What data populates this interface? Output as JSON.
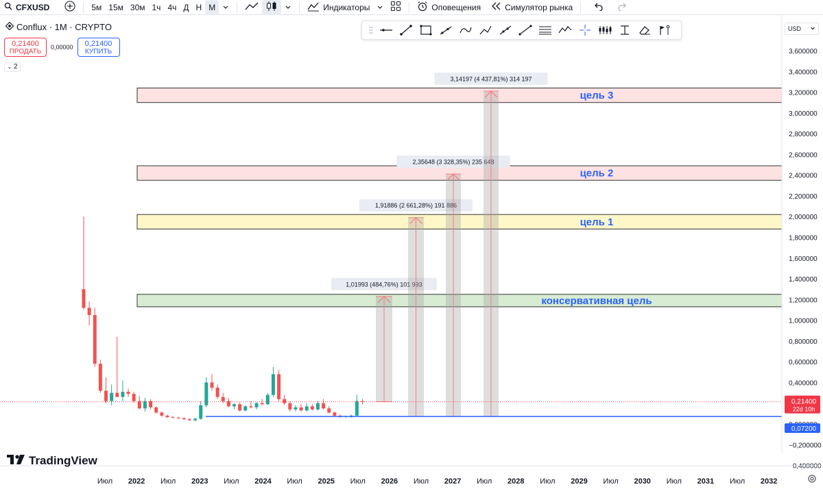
{
  "toolbar": {
    "symbol": "CFXUSD",
    "intervals": [
      "5м",
      "15м",
      "30м",
      "1ч",
      "4ч",
      "Д",
      "Н",
      "М"
    ],
    "active_interval": "М",
    "indicators_label": "Индикаторы",
    "alerts_label": "Оповещения",
    "replay_label": "Симулятор рынка"
  },
  "legend": {
    "title": "Conflux · 1M · CRYPTO"
  },
  "trade": {
    "sell_price": "0,21400",
    "sell_label": "ПРОДАТЬ",
    "spread": "0,00000",
    "buy_price": "0,21400",
    "buy_label": "КУПИТЬ"
  },
  "collapse": {
    "count": "2"
  },
  "currency": {
    "label": "USD"
  },
  "price_axis": {
    "ticks": [
      "3,600000",
      "3,400000",
      "3,200000",
      "3,000000",
      "2,800000",
      "2,600000",
      "2,400000",
      "2,200000",
      "2,000000",
      "1,800000",
      "1,600000",
      "1,400000",
      "1,200000",
      "1,000000",
      "0,800000",
      "0,600000",
      "0,400000",
      "0,000000",
      "−0,200000",
      "−0,400000"
    ],
    "tick_values": [
      3.6,
      3.4,
      3.2,
      3.0,
      2.8,
      2.6,
      2.4,
      2.2,
      2.0,
      1.8,
      1.6,
      1.4,
      1.2,
      1.0,
      0.8,
      0.6,
      0.4,
      0.0,
      -0.2,
      -0.4
    ],
    "last_price": "0,21400",
    "last_price_value": 0.214,
    "countdown": "22d 10h",
    "support_label": "0,07200",
    "support_value": 0.072
  },
  "time_axis": {
    "labels": [
      "Июл",
      "2022",
      "Июл",
      "2023",
      "Июл",
      "2024",
      "Июл",
      "2025",
      "Июл",
      "2026",
      "Июл",
      "2027",
      "Июл",
      "2028",
      "Июл",
      "2029",
      "Июл",
      "2030",
      "Июл",
      "2031",
      "Июл",
      "2032"
    ]
  },
  "zones": [
    {
      "label": "консервативная цель",
      "low": 1.13,
      "high": 1.25,
      "color": "#d8ecd4",
      "border": "#333333"
    },
    {
      "label": "цель 1",
      "low": 1.88,
      "high": 2.02,
      "color": "#fff7c8",
      "border": "#333333"
    },
    {
      "label": "цель 2",
      "low": 2.35,
      "high": 2.49,
      "color": "#fde2e2",
      "border": "#333333"
    },
    {
      "label": "цель 3",
      "low": 3.1,
      "high": 3.24,
      "color": "#fde2e2",
      "border": "#333333"
    }
  ],
  "measures": [
    {
      "label": "1,01993 (484,76%) 101 993",
      "top": 1.23
    },
    {
      "label": "1,91886 (2 661,28%) 191 886",
      "top": 1.99
    },
    {
      "label": "2,35648 (3 328,35%) 235 648",
      "top": 2.41
    },
    {
      "label": "3,14197 (4 437,81%) 314 197",
      "top": 3.21
    }
  ],
  "colors": {
    "up": "#26a69a",
    "down": "#ef5350",
    "zone_text": "#2962ff",
    "support": "#2962ff",
    "last": "#f23645"
  },
  "brand": {
    "name": "TradingView"
  },
  "chart_data": {
    "type": "candlestick",
    "ylim": [
      -0.4,
      3.65
    ],
    "candles": [
      {
        "o": 1.3,
        "h": 2.0,
        "l": 1.1,
        "c": 1.12
      },
      {
        "o": 1.12,
        "h": 1.18,
        "l": 0.95,
        "c": 1.05
      },
      {
        "o": 1.05,
        "h": 1.12,
        "l": 0.55,
        "c": 0.58
      },
      {
        "o": 0.58,
        "h": 0.62,
        "l": 0.3,
        "c": 0.32
      },
      {
        "o": 0.32,
        "h": 0.45,
        "l": 0.2,
        "c": 0.22
      },
      {
        "o": 0.22,
        "h": 0.38,
        "l": 0.18,
        "c": 0.3
      },
      {
        "o": 0.3,
        "h": 0.84,
        "l": 0.26,
        "c": 0.26
      },
      {
        "o": 0.26,
        "h": 0.42,
        "l": 0.22,
        "c": 0.31
      },
      {
        "o": 0.31,
        "h": 0.34,
        "l": 0.26,
        "c": 0.29
      },
      {
        "o": 0.29,
        "h": 0.31,
        "l": 0.2,
        "c": 0.22
      },
      {
        "o": 0.22,
        "h": 0.27,
        "l": 0.14,
        "c": 0.15
      },
      {
        "o": 0.15,
        "h": 0.25,
        "l": 0.12,
        "c": 0.22
      },
      {
        "o": 0.22,
        "h": 0.24,
        "l": 0.14,
        "c": 0.16
      },
      {
        "o": 0.16,
        "h": 0.17,
        "l": 0.1,
        "c": 0.11
      },
      {
        "o": 0.11,
        "h": 0.12,
        "l": 0.07,
        "c": 0.08
      },
      {
        "o": 0.08,
        "h": 0.09,
        "l": 0.06,
        "c": 0.065
      },
      {
        "o": 0.065,
        "h": 0.075,
        "l": 0.055,
        "c": 0.06
      },
      {
        "o": 0.06,
        "h": 0.07,
        "l": 0.05,
        "c": 0.055
      },
      {
        "o": 0.055,
        "h": 0.065,
        "l": 0.04,
        "c": 0.045
      },
      {
        "o": 0.045,
        "h": 0.055,
        "l": 0.03,
        "c": 0.035
      },
      {
        "o": 0.035,
        "h": 0.06,
        "l": 0.025,
        "c": 0.05
      },
      {
        "o": 0.05,
        "h": 0.22,
        "l": 0.04,
        "c": 0.18
      },
      {
        "o": 0.18,
        "h": 0.45,
        "l": 0.16,
        "c": 0.4
      },
      {
        "o": 0.4,
        "h": 0.48,
        "l": 0.32,
        "c": 0.35
      },
      {
        "o": 0.35,
        "h": 0.38,
        "l": 0.24,
        "c": 0.26
      },
      {
        "o": 0.26,
        "h": 0.3,
        "l": 0.2,
        "c": 0.22
      },
      {
        "o": 0.22,
        "h": 0.25,
        "l": 0.16,
        "c": 0.17
      },
      {
        "o": 0.17,
        "h": 0.2,
        "l": 0.14,
        "c": 0.19
      },
      {
        "o": 0.19,
        "h": 0.21,
        "l": 0.12,
        "c": 0.13
      },
      {
        "o": 0.13,
        "h": 0.18,
        "l": 0.12,
        "c": 0.17
      },
      {
        "o": 0.17,
        "h": 0.22,
        "l": 0.15,
        "c": 0.16
      },
      {
        "o": 0.16,
        "h": 0.21,
        "l": 0.14,
        "c": 0.2
      },
      {
        "o": 0.2,
        "h": 0.24,
        "l": 0.18,
        "c": 0.19
      },
      {
        "o": 0.19,
        "h": 0.3,
        "l": 0.18,
        "c": 0.28
      },
      {
        "o": 0.28,
        "h": 0.55,
        "l": 0.26,
        "c": 0.48
      },
      {
        "o": 0.48,
        "h": 0.52,
        "l": 0.22,
        "c": 0.24
      },
      {
        "o": 0.24,
        "h": 0.28,
        "l": 0.18,
        "c": 0.2
      },
      {
        "o": 0.2,
        "h": 0.22,
        "l": 0.12,
        "c": 0.14
      },
      {
        "o": 0.14,
        "h": 0.18,
        "l": 0.12,
        "c": 0.16
      },
      {
        "o": 0.16,
        "h": 0.19,
        "l": 0.12,
        "c": 0.13
      },
      {
        "o": 0.13,
        "h": 0.2,
        "l": 0.12,
        "c": 0.17
      },
      {
        "o": 0.17,
        "h": 0.19,
        "l": 0.13,
        "c": 0.14
      },
      {
        "o": 0.14,
        "h": 0.22,
        "l": 0.13,
        "c": 0.2
      },
      {
        "o": 0.2,
        "h": 0.24,
        "l": 0.14,
        "c": 0.15
      },
      {
        "o": 0.15,
        "h": 0.17,
        "l": 0.1,
        "c": 0.11
      },
      {
        "o": 0.11,
        "h": 0.12,
        "l": 0.07,
        "c": 0.08
      },
      {
        "o": 0.08,
        "h": 0.09,
        "l": 0.06,
        "c": 0.07
      },
      {
        "o": 0.07,
        "h": 0.08,
        "l": 0.06,
        "c": 0.075
      },
      {
        "o": 0.075,
        "h": 0.09,
        "l": 0.06,
        "c": 0.08
      },
      {
        "o": 0.08,
        "h": 0.28,
        "l": 0.07,
        "c": 0.22
      },
      {
        "o": 0.22,
        "h": 0.24,
        "l": 0.19,
        "c": 0.214
      }
    ]
  }
}
